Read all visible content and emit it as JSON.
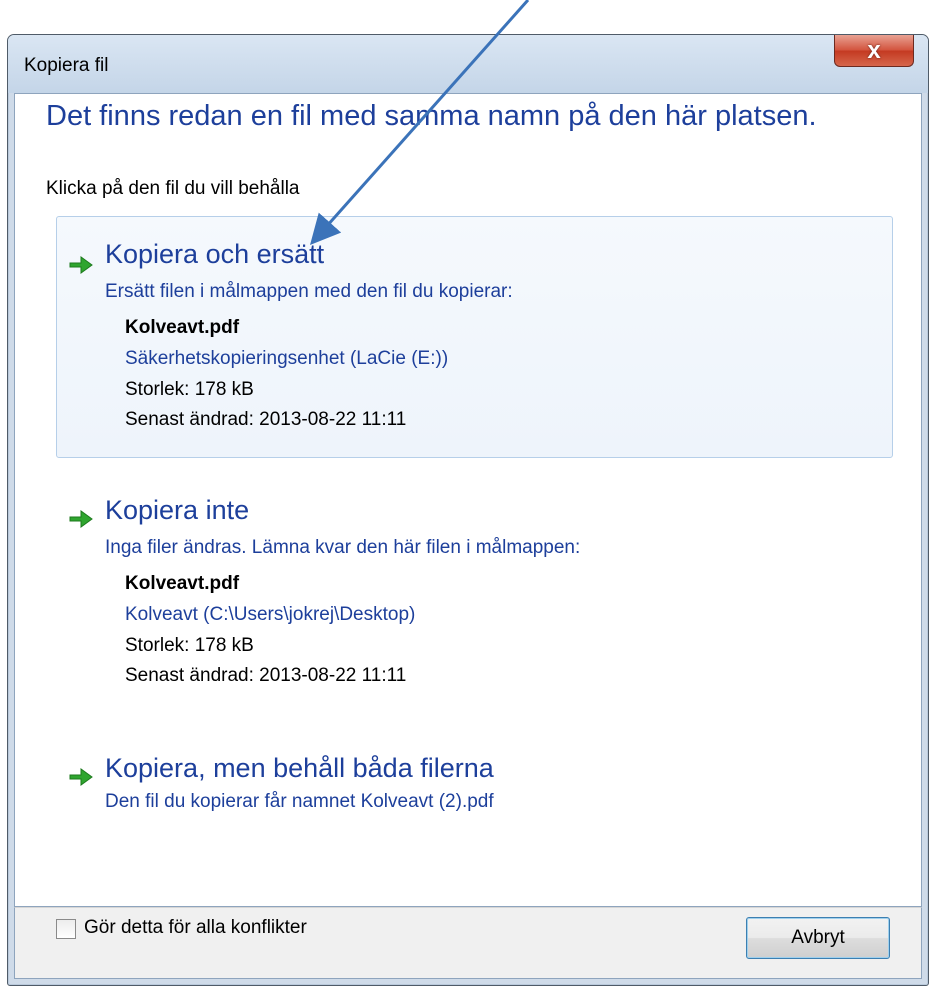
{
  "window": {
    "title": "Kopiera fil",
    "close_glyph": "x"
  },
  "dialog": {
    "heading": "Det finns redan en fil med samma namn på den här platsen.",
    "subheading": "Klicka på den fil du vill behålla"
  },
  "options": [
    {
      "title": "Kopiera och ersätt",
      "description": "Ersätt filen i målmappen med den fil du kopierar:",
      "file_name": "Kolveavt.pdf",
      "location": "Säkerhetskopieringsenhet (LaCie (E:))",
      "size": "Storlek: 178 kB",
      "modified": "Senast ändrad: 2013-08-22 11:11",
      "icon": "green-arrow-icon"
    },
    {
      "title": "Kopiera inte",
      "description": "Inga filer ändras. Lämna kvar den här filen i målmappen:",
      "file_name": "Kolveavt.pdf",
      "location": "Kolveavt (C:\\Users\\jokrej\\Desktop)",
      "size": "Storlek: 178 kB",
      "modified": "Senast ändrad: 2013-08-22 11:11",
      "icon": "green-arrow-icon"
    },
    {
      "title": "Kopiera, men behåll båda filerna",
      "description": "Den fil du kopierar får namnet Kolveavt (2).pdf",
      "icon": "green-arrow-icon"
    }
  ],
  "footer": {
    "checkbox_label": "Gör detta för alla konflikter",
    "checkbox_checked": false,
    "cancel_label": "Avbryt"
  },
  "colors": {
    "link_blue": "#1d3f9b",
    "arrow_green": "#2fa52f",
    "annotation_arrow": "#3b73b9"
  }
}
